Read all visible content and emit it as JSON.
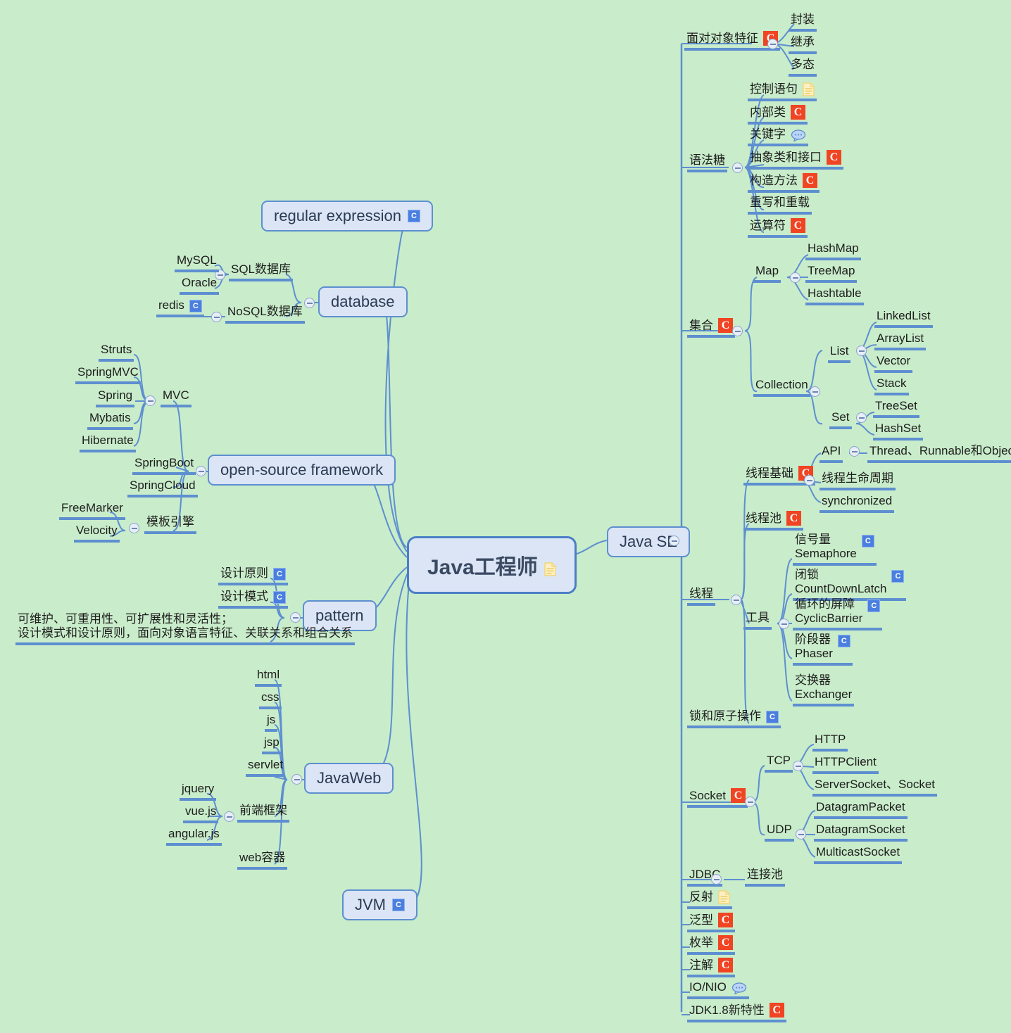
{
  "meta": {
    "background_color": "#c9ecca",
    "line_color": "#5d8fd0",
    "box_fill": "#dbe5f5",
    "icon_c_red": "#f04423",
    "icon_c_blue": "#4a7fe0",
    "icon_doc": "#f5d884"
  },
  "root": {
    "label": "Java工程师",
    "icon": "doc-icon"
  },
  "branches": {
    "java_se": {
      "label": "Java SE"
    },
    "regular_expression": {
      "label": "regular expression",
      "icon": "c-blue-icon"
    },
    "database": {
      "label": "database"
    },
    "open_source_framework": {
      "label": "open-source framework"
    },
    "pattern": {
      "label": "pattern"
    },
    "javaweb": {
      "label": "JavaWeb"
    },
    "jvm": {
      "label": "JVM",
      "icon": "c-blue-icon"
    }
  },
  "java_se_children": {
    "oop": {
      "label": "面对对象特征",
      "icon": "c-red-icon",
      "children": [
        "封装",
        "继承",
        "多态"
      ]
    },
    "syntax_sugar": {
      "label": "语法糖",
      "children": [
        {
          "label": "控制语句",
          "icon": "doc-icon"
        },
        {
          "label": "内部类",
          "icon": "c-red-icon"
        },
        {
          "label": "关键字",
          "icon": "bubble-icon"
        },
        {
          "label": "抽象类和接口",
          "icon": "c-red-icon"
        },
        {
          "label": "构造方法",
          "icon": "c-red-icon"
        },
        {
          "label": "重写和重载",
          "icon": null
        },
        {
          "label": "运算符",
          "icon": "c-red-icon"
        }
      ]
    },
    "collections": {
      "label": "集合",
      "icon": "c-red-icon",
      "map": {
        "label": "Map",
        "children": [
          "HashMap",
          "TreeMap",
          "Hashtable"
        ]
      },
      "collection": {
        "label": "Collection",
        "list": {
          "label": "List",
          "children": [
            "LinkedList",
            "ArrayList",
            "Vector",
            "Stack"
          ]
        },
        "set": {
          "label": "Set",
          "children": [
            "TreeSet",
            "HashSet"
          ]
        }
      }
    },
    "threads": {
      "label": "线程",
      "basics": {
        "label": "线程基础",
        "icon": "c-red-icon",
        "api": {
          "label": "API",
          "children": [
            "Thread、Runnable和Object"
          ]
        },
        "others": [
          "线程生命周期",
          "synchronized"
        ]
      },
      "pool": {
        "label": "线程池",
        "icon": "c-red-icon"
      },
      "tools": {
        "label": "工具",
        "children": [
          {
            "line1": "信号量",
            "line2": "Semaphore",
            "icon": "c-blue-icon"
          },
          {
            "line1": "闭锁",
            "line2": "CountDownLatch",
            "icon": "c-blue-icon"
          },
          {
            "line1": "循环的屏障",
            "line2": "CyclicBarrier",
            "icon": "c-blue-icon"
          },
          {
            "line1": "阶段器",
            "line2": "Phaser",
            "icon": "c-blue-icon"
          },
          {
            "line1": "交换器",
            "line2": "Exchanger",
            "icon": null
          }
        ]
      },
      "locks": {
        "label": "锁和原子操作",
        "icon": "c-blue-icon"
      }
    },
    "socket": {
      "label": "Socket",
      "icon": "c-red-icon",
      "tcp": {
        "label": "TCP",
        "children": [
          "HTTP",
          "HTTPClient",
          "ServerSocket、Socket"
        ]
      },
      "udp": {
        "label": "UDP",
        "children": [
          "DatagramPacket",
          "DatagramSocket",
          "MulticastSocket"
        ]
      }
    },
    "jdbc": {
      "label": "JDBC",
      "children": [
        "连接池"
      ]
    },
    "misc": [
      {
        "label": "反射",
        "icon": "doc-icon"
      },
      {
        "label": "泛型",
        "icon": "c-red-icon"
      },
      {
        "label": "枚举",
        "icon": "c-red-icon"
      },
      {
        "label": "注解",
        "icon": "c-red-icon"
      },
      {
        "label": "IO/NIO",
        "icon": "bubble-icon"
      },
      {
        "label": "JDK1.8新特性",
        "icon": "c-red-icon"
      }
    ]
  },
  "database_children": {
    "sql": {
      "label": "SQL数据库",
      "children": [
        "MySQL",
        "Oracle"
      ]
    },
    "nosql": {
      "label": "NoSQL数据库",
      "children": [
        {
          "label": "redis",
          "icon": "c-blue-icon"
        }
      ]
    }
  },
  "framework_children": {
    "mvc": {
      "label": "MVC",
      "children": [
        "Struts",
        "SpringMVC",
        "Spring",
        "Mybatis",
        "Hibernate"
      ]
    },
    "springboot": {
      "label": "SpringBoot"
    },
    "springcloud": {
      "label": "SpringCloud"
    },
    "template_engine": {
      "label": "模板引擎",
      "children": [
        "FreeMarker",
        "Velocity"
      ]
    }
  },
  "pattern_children": [
    {
      "label": "设计原则",
      "icon": "c-blue-icon"
    },
    {
      "label": "设计模式",
      "icon": "c-blue-icon"
    },
    {
      "line1": "可维护、可重用性、可扩展性和灵活性；",
      "line2": "设计模式和设计原则，面向对象语言特征、关联关系和组合关系"
    }
  ],
  "javaweb_children": {
    "items": [
      "html",
      "css",
      "js",
      "jsp",
      "servlet"
    ],
    "frontend": {
      "label": "前端框架",
      "children": [
        "jquery",
        "vue.js",
        "angular.js"
      ]
    },
    "container": {
      "label": "web容器"
    }
  }
}
